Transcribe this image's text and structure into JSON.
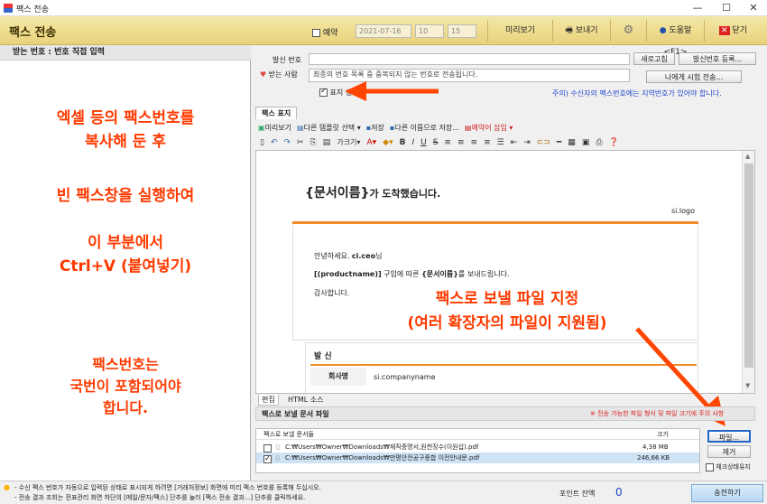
{
  "window": {
    "title": "팩스 전송",
    "minimize": "—",
    "maximize": "☐",
    "close": "✕"
  },
  "header": {
    "title": "팩스 전송",
    "reserve_label": "예약",
    "date": "2021-07-16",
    "hour": "10",
    "minute": "15",
    "preview": "미리보기",
    "send": "보내기",
    "help": "도움말<F1>",
    "close": "닫기"
  },
  "left": {
    "header": "받는 번호 : 번호 직접 입력",
    "annotation1": [
      "엑셀 등의 팩스번호를",
      "복사해 둔 후"
    ],
    "annotation2": "빈 팩스창을 실행하여",
    "annotation3": [
      "이 부분에서",
      "Ctrl+V (붙여넣기)"
    ],
    "annotation4": [
      "팩스번호는",
      "국번이 포함되어야",
      "합니다."
    ]
  },
  "sender": {
    "label": "발신 번호",
    "refresh": "새로고침",
    "register": "발신번호 등록..."
  },
  "recipient": {
    "label": "받는 사람",
    "value": "최종의 번호 목록 중 중복되지 않는 번호로 전송됩니다.",
    "test_send": "나에게 시험 전송...",
    "show_cover_label": "표지 생략",
    "notice": "주의) 수신자의 팩스번호에는 지역번호가 있어야 합니다."
  },
  "editor": {
    "section_tab": "팩스 표지",
    "toolbar1": [
      "미리보기",
      "다른 템플릿 선택 ▾",
      "저장",
      "다른 이름으로 저장...",
      "예약어 삽입 ▾"
    ],
    "font_size": "크기",
    "doc_title_var": "{문서이름}",
    "doc_title_rest": "가 도착했습니다.",
    "logo": "si.logo",
    "greeting": "안녕하세요.",
    "ceo": "ci.ceo",
    "greeting_suffix": "님",
    "body_var1": "[(productname)]",
    "body_mid": " 구입에 따른 ",
    "body_var2": "{문서이름}",
    "body_end": "를 보내드립니다.",
    "thanks": "감사합니다.",
    "sender_section": "발 신",
    "company_label": "회사명",
    "company_value": "si.companyname",
    "annotation": [
      "팩스로 보낼 파일 지정",
      "(여러 확장자의 파일이 지원됨)"
    ],
    "tab_edit": "편집",
    "tab_html": "HTML 소스"
  },
  "files": {
    "header": "팩스로 보낼 문서 파일",
    "warning": "※ 전송 가능한 파일 형식 및 파일 크기에 주의 사항",
    "col_name": "팩스로 보낼 문서들",
    "col_size": "크기",
    "rows": [
      {
        "name": "C:₩Users₩Owner₩Downloads₩재직증명서,원천징수(이원섭).pdf",
        "size": "4,38 MB"
      },
      {
        "name": "C:₩Users₩Owner₩Downloads₩만평안전공구종합 이전안내문.pdf",
        "size": "246,66 KB"
      }
    ],
    "file_button": "파일...",
    "remove_button": "제거",
    "check_keep": "체크상태유지"
  },
  "bottom": {
    "note1a": "- 수신 팩스 번호가 자동으로 입력된 상태로 표시되게 하려면 [거래처정보] 화면에 미리 팩스 번호를 등록해 두십시오.",
    "note2": "- 전송 결과 조회는 전표관리 화면 하단의 [메일/문자/팩스] 단추를 눌러 [팩스 전송 결과...] 단추를 클릭하세요.",
    "points_label": "포인트 잔액",
    "points_value": "0",
    "send_button": "송전하기"
  }
}
